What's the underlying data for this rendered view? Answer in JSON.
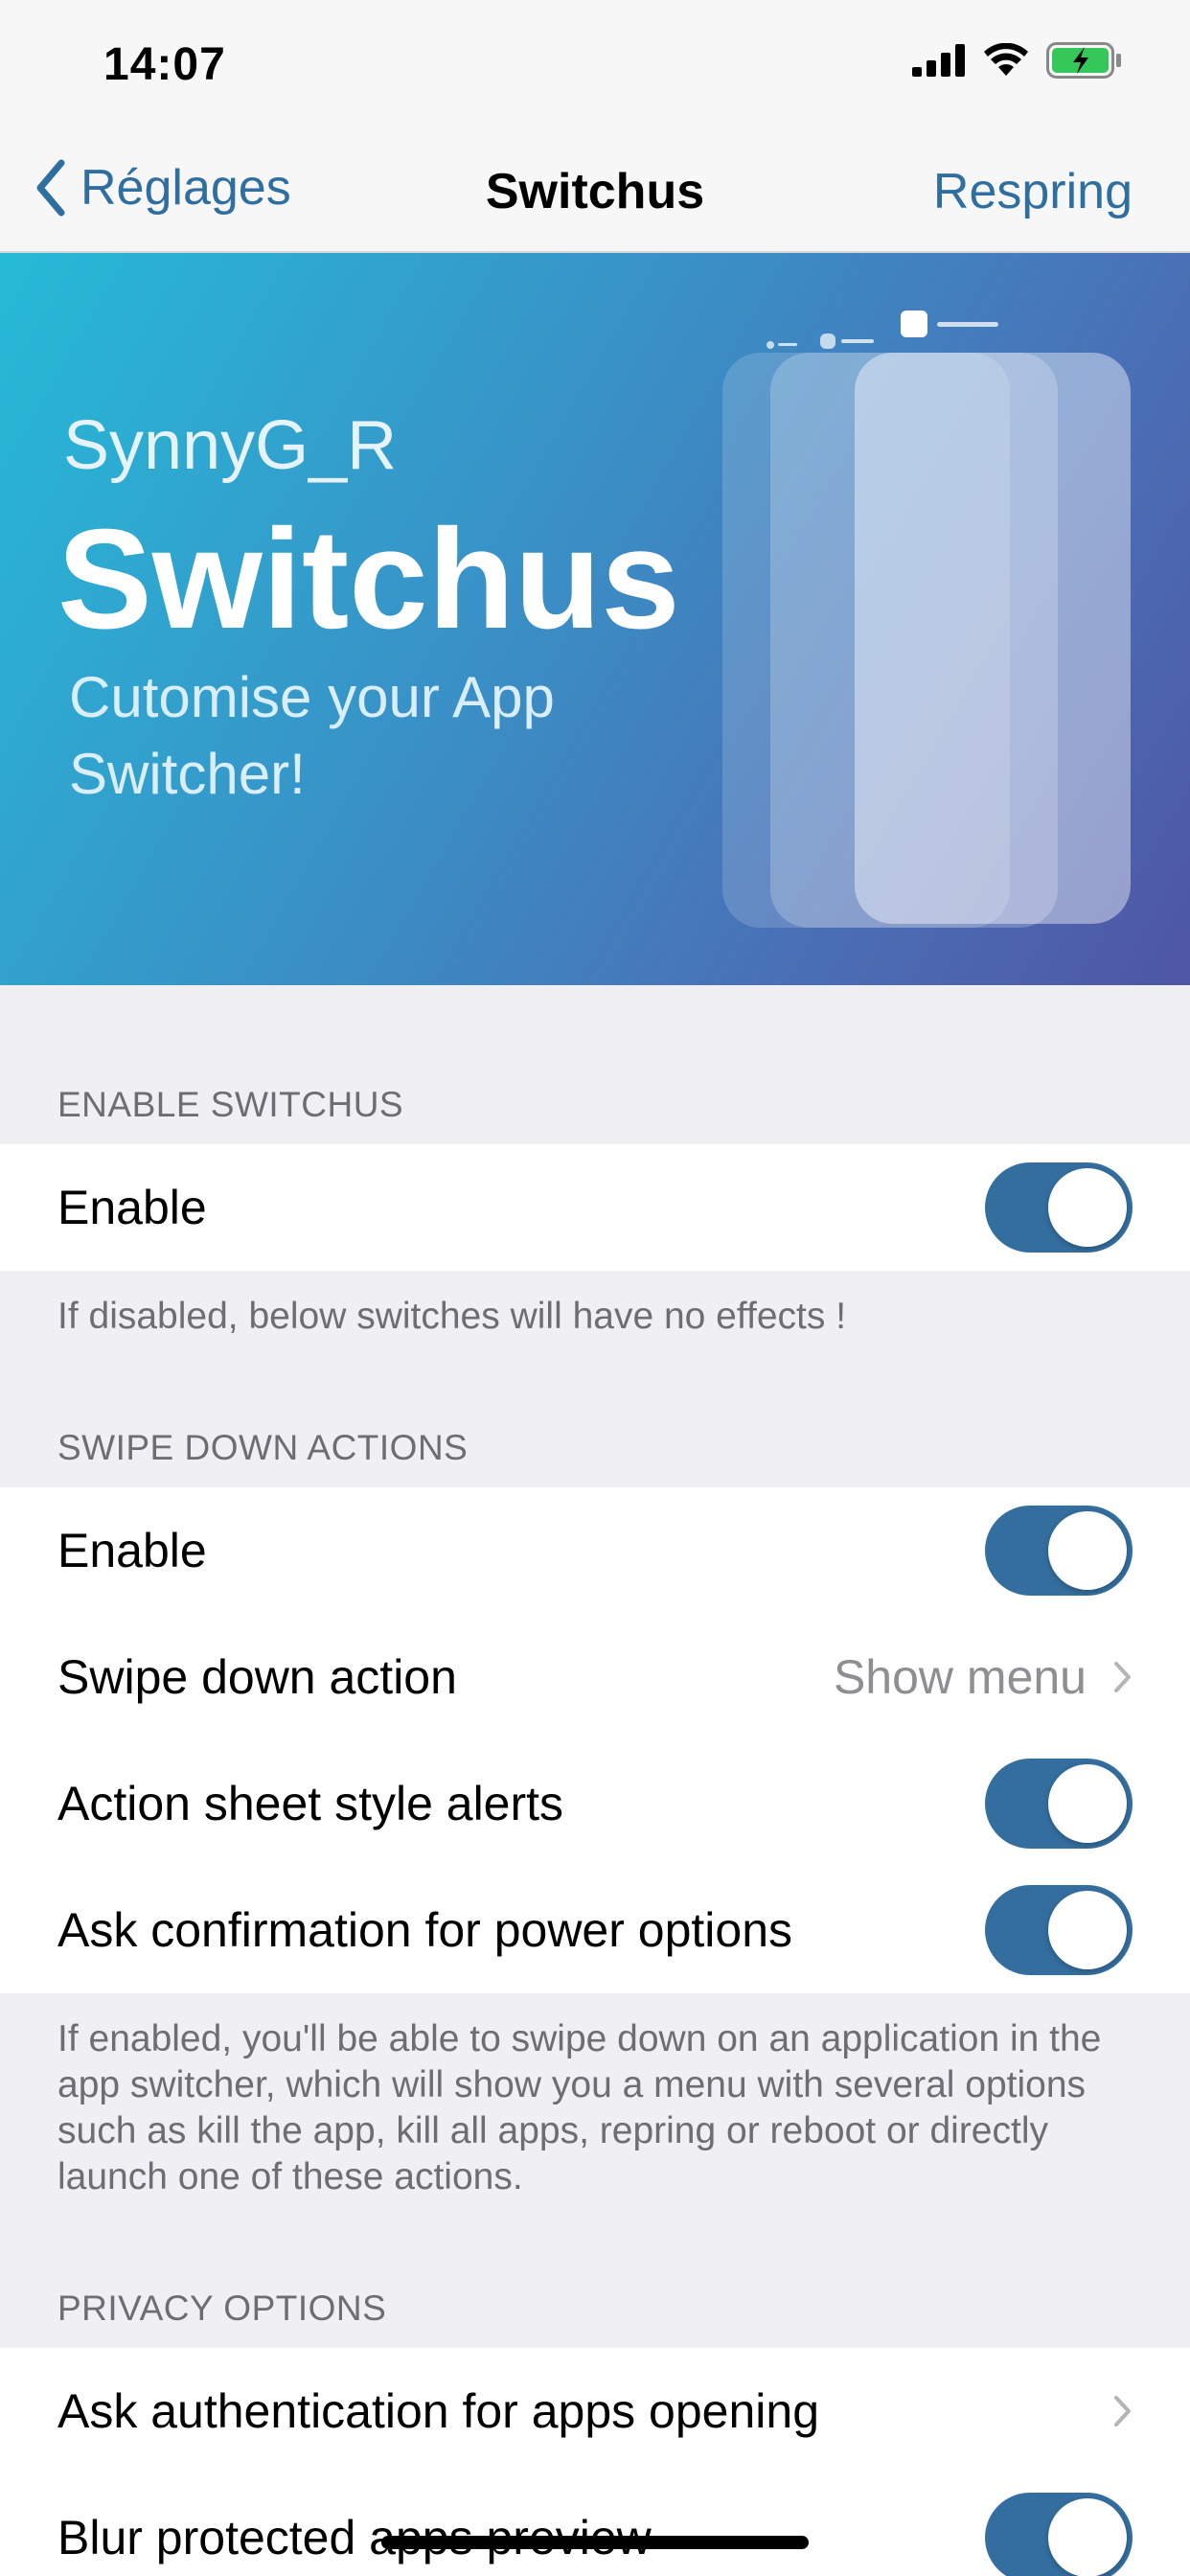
{
  "status_bar": {
    "time": "14:07"
  },
  "nav": {
    "back_label": "Réglages",
    "title": "Switchus",
    "right_button": "Respring"
  },
  "banner": {
    "author": "SynnyG_R",
    "title": "Switchus",
    "subtitle": "Cutomise your App Switcher!"
  },
  "sections": {
    "enable": {
      "header": "ENABLE SWITCHUS",
      "rows": [
        {
          "label": "Enable",
          "toggle_on": true
        }
      ],
      "footer": "If disabled, below switches will have no effects !"
    },
    "swipe": {
      "header": "SWIPE DOWN ACTIONS",
      "rows": [
        {
          "label": "Enable",
          "toggle_on": true
        },
        {
          "label": "Swipe down action",
          "value": "Show menu"
        },
        {
          "label": "Action sheet style alerts",
          "toggle_on": true
        },
        {
          "label": "Ask confirmation for power options",
          "toggle_on": true
        }
      ],
      "footer": "If enabled, you'll be able to swipe down on an application in the app switcher, which will show you a menu with several options such as kill the app, kill all apps, repring or reboot or directly launch one of these actions."
    },
    "privacy": {
      "header": "PRIVACY OPTIONS",
      "rows": [
        {
          "label": "Ask authentication for apps opening"
        },
        {
          "label": "Blur protected apps preview",
          "toggle_on": true
        }
      ]
    }
  },
  "colors": {
    "accent": "#346e9e",
    "link": "#2f6f9f",
    "background": "#efeff4"
  }
}
